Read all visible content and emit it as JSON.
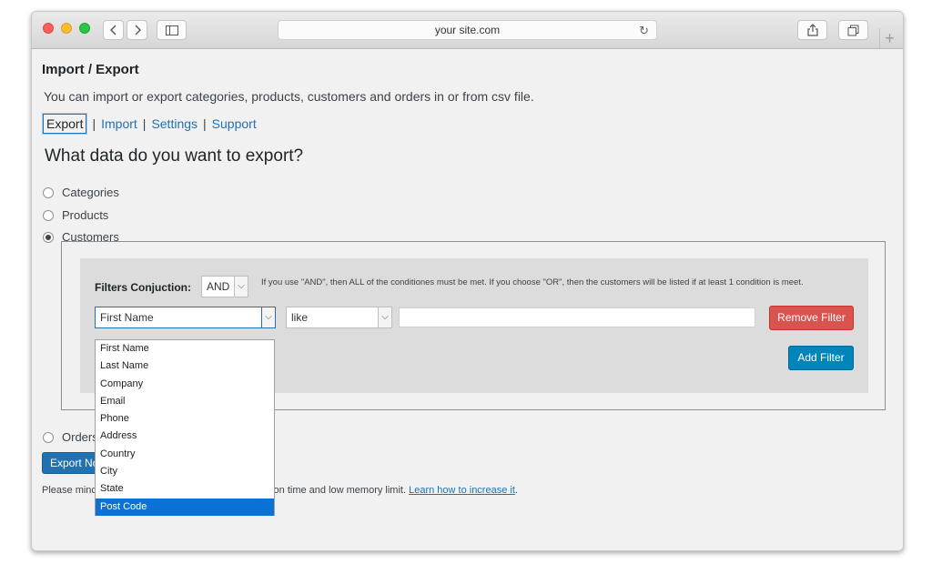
{
  "browser": {
    "url": "your site.com"
  },
  "page": {
    "title": "Import / Export",
    "description": "You can import or export categories, products, customers and orders in or from csv file.",
    "tabs": [
      "Export",
      "Import",
      "Settings",
      "Support"
    ],
    "heading": "What data do you want to export?",
    "options": [
      "Categories",
      "Products",
      "Customers",
      "Orders"
    ],
    "selected_option": "Customers"
  },
  "filters": {
    "conjunction_label": "Filters Conjuction:",
    "conjunction_value": "AND",
    "hint": "If you use \"AND\", then ALL of the conditiones must be met. If you choose \"OR\", then the customers will be listed if at least 1 condition is meet.",
    "field_value": "First Name",
    "operator_value": "like",
    "remove_label": "Remove Filter",
    "add_label": "Add Filter",
    "field_options": [
      "First Name",
      "Last Name",
      "Company",
      "Email",
      "Phone",
      "Address",
      "Country",
      "City",
      "State",
      "Post Code"
    ],
    "highlighted_option": "Post Code"
  },
  "footer": {
    "export_label": "Export No",
    "note_start": "Please minc",
    "note_middle": "ution time and low memory limit.",
    "note_link": "Learn how to increase it",
    "note_end": "."
  }
}
